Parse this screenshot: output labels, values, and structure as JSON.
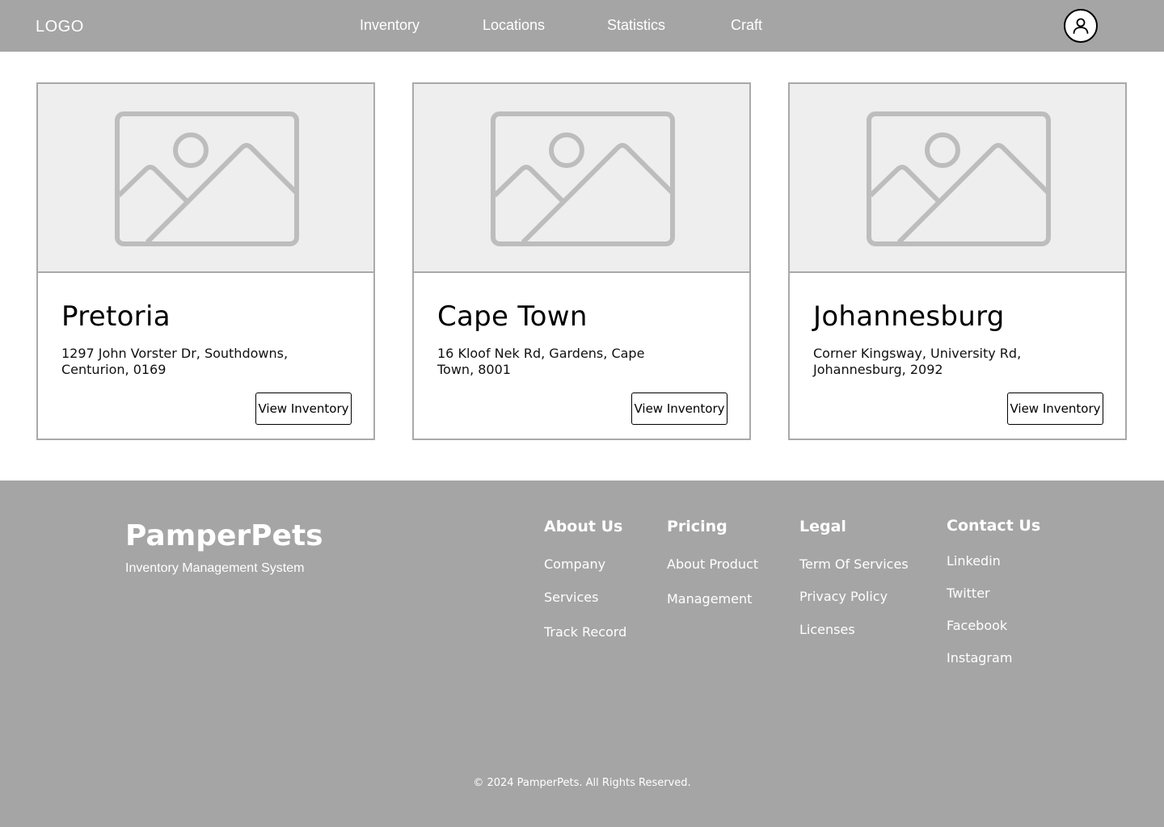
{
  "header": {
    "logo": "LOGO",
    "nav": [
      "Inventory",
      "Locations",
      "Statistics",
      "Craft"
    ],
    "avatar_icon": "user-icon"
  },
  "cards": [
    {
      "title": "Pretoria",
      "address": "1297 John Vorster Dr, Southdowns, Centurion, 0169",
      "button": "View Inventory",
      "image_icon": "image-placeholder-icon"
    },
    {
      "title": "Cape Town",
      "address": "16 Kloof Nek Rd, Gardens, Cape Town, 8001",
      "button": "View Inventory",
      "image_icon": "image-placeholder-icon"
    },
    {
      "title": "Johannesburg",
      "address": "Corner Kingsway, University Rd, Johannesburg, 2092",
      "button": "View Inventory",
      "image_icon": "image-placeholder-icon"
    }
  ],
  "footer": {
    "brand": "PamperPets",
    "tagline": "Inventory Management System",
    "about": {
      "heading": "About Us",
      "links": [
        "Company",
        "Services",
        "Track Record"
      ]
    },
    "pricing": {
      "heading": "Pricing",
      "links": [
        "About Product",
        "Management"
      ]
    },
    "legal": {
      "heading": "Legal",
      "links": [
        "Term Of Services",
        "Privacy Policy",
        "Licenses"
      ]
    },
    "contact": {
      "heading": "Contact Us",
      "links": [
        "Linkedin",
        "Twitter",
        "Facebook",
        "Instagram"
      ]
    },
    "copyright": "© 2024 PamperPets. All Rights Reserved."
  },
  "colors": {
    "header_bg": "#a5a5a5",
    "footer_bg": "#a5a5a5",
    "card_border": "#a9a9a9",
    "image_bg": "#eeeeee",
    "placeholder_stroke": "#bdbdbd"
  }
}
